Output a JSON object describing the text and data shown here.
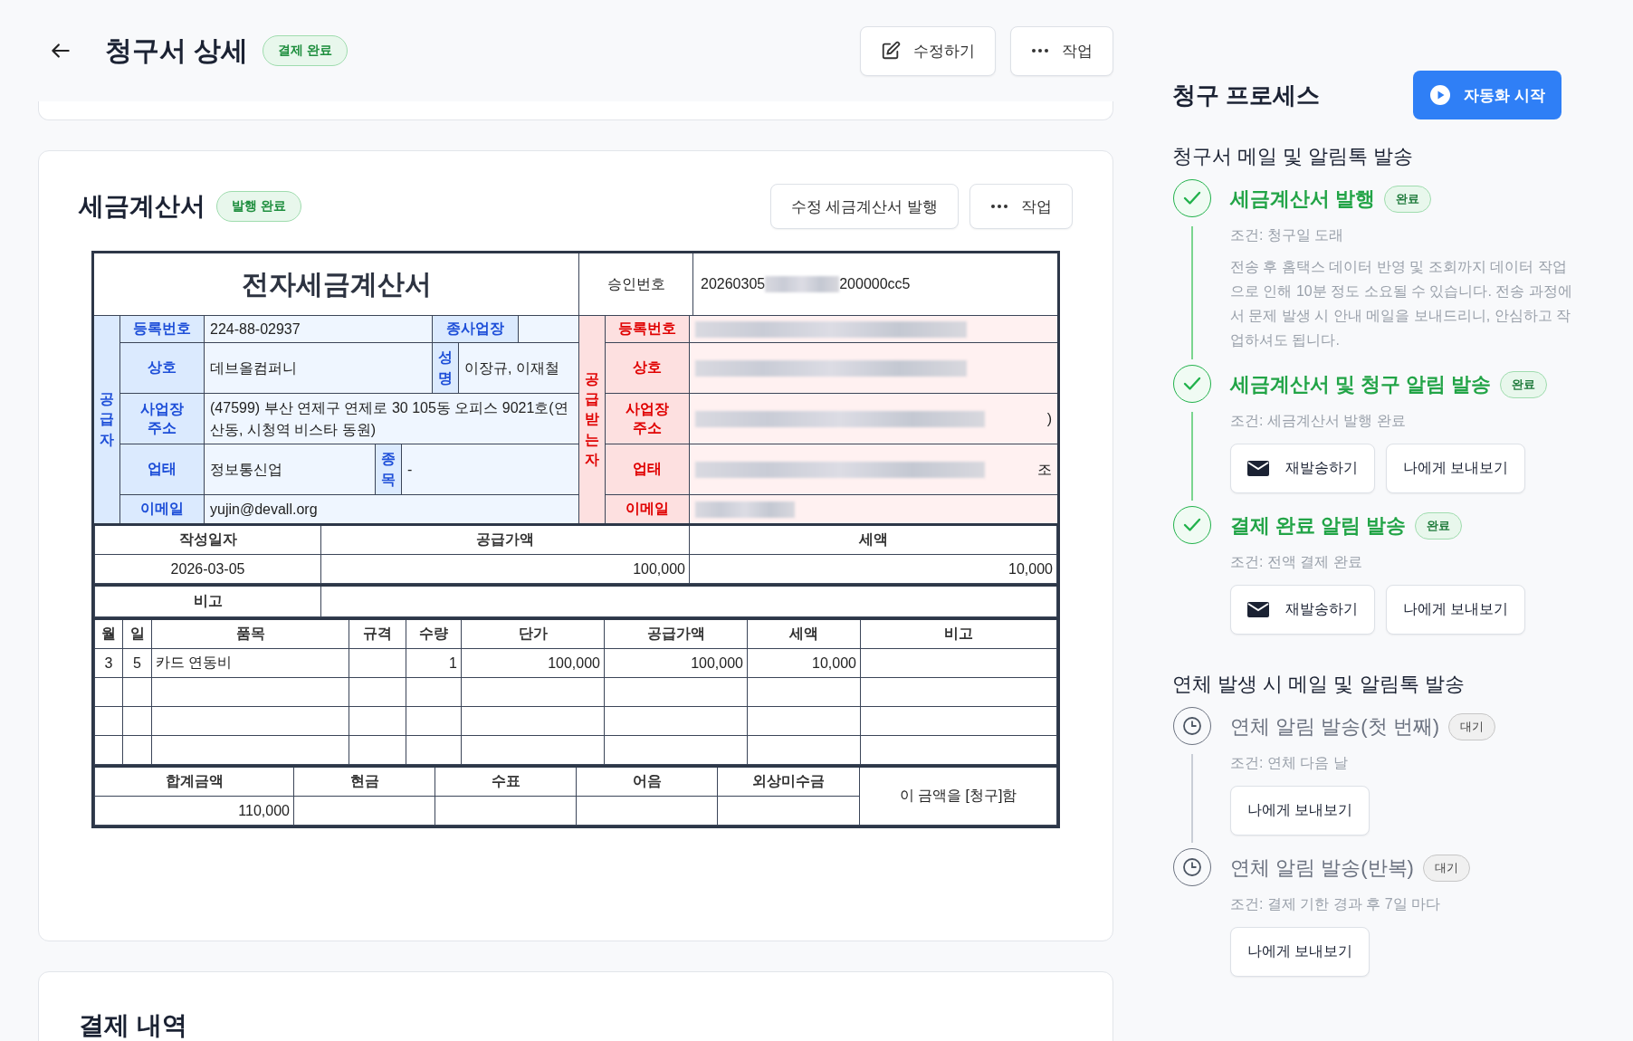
{
  "header": {
    "title": "청구서 상세",
    "status": "결제 완료",
    "buttons": [
      {
        "kind": "edit",
        "label": "수정하기"
      },
      {
        "kind": "more",
        "label": "작업"
      }
    ]
  },
  "tax_invoice": {
    "title": "세금계산서",
    "status": "발행 완료",
    "buttons": [
      {
        "kind": "plain",
        "label": "수정 세금계산서 발행"
      },
      {
        "kind": "more",
        "label": "작업"
      }
    ],
    "document": {
      "title": "전자세금계산서",
      "approval_label": "승인번호",
      "approval_number_start": "20260305",
      "approval_number_end": "200000cc5",
      "supplier": {
        "side_label": "공급자",
        "reg_label": "등록번호",
        "reg": "224-88-02937",
        "branch_label": "종사업장",
        "name_label": "상호",
        "name": "데브올컴퍼니",
        "rep_label": "성명",
        "rep": "이장규, 이재철",
        "addr_label": "사업장 주소",
        "addr": "(47599) 부산 연제구 연제로 30 105동 오피스 9021호(연산동, 시청역 비스타 동원)",
        "biz_label": "업태",
        "biz": "정보통신업",
        "item_label": "종목",
        "item": "-",
        "email_label": "이메일",
        "email": "yujin@devall.org"
      },
      "recipient": {
        "side_label": "공급받는자",
        "reg_label": "등록번호",
        "name_label": "상호",
        "addr_label": "사업장 주소",
        "addr_tail": ")",
        "biz_label": "업태",
        "item_tail": "조",
        "email_label": "이메일"
      },
      "summary": {
        "headers": [
          "작성일자",
          "공급가액",
          "세액"
        ],
        "values": [
          "2026-03-05",
          "100,000",
          "10,000"
        ]
      },
      "remarks_label": "비고",
      "items": {
        "columns": [
          "월",
          "일",
          "품목",
          "규격",
          "수량",
          "단가",
          "공급가액",
          "세액",
          "비고"
        ],
        "rows": [
          {
            "month": "3",
            "day": "5",
            "name": "카드 연동비",
            "qty": "1",
            "unit_price": "100,000",
            "supply": "100,000",
            "tax": "10,000"
          }
        ]
      },
      "totals": {
        "headers": [
          "합계금액",
          "현금",
          "수표",
          "어음",
          "외상미수금"
        ],
        "total": "110,000",
        "claim_note": "이 금액을 [청구]함"
      }
    }
  },
  "payment_section": {
    "title": "결제 내역"
  },
  "process": {
    "title": "청구 프로세스",
    "start_button": "자동화 시작",
    "groups": [
      {
        "title": "청구서 메일 및 알림톡 발송",
        "steps": [
          {
            "completed": true,
            "title": "세금계산서 발행",
            "badge": "완료",
            "condition": "조건: 청구일 도래",
            "note": "전송 후 홈택스 데이터 반영 및 조회까지 데이터 작업으로 인해 10분 정도 소요될 수 있습니다. 전송 과정에서 문제 발생 시 안내 메일을 보내드리니, 안심하고 작업하셔도 됩니다."
          },
          {
            "completed": true,
            "title": "세금계산서 및 청구 알림 발송",
            "badge": "완료",
            "condition": "조건: 세금계산서 발행 완료",
            "actions": [
              {
                "kind": "resend",
                "label": "재발송하기"
              },
              {
                "kind": "preview",
                "label": "나에게 보내보기"
              }
            ]
          },
          {
            "completed": true,
            "title": "결제 완료 알림 발송",
            "badge": "완료",
            "condition": "조건: 전액 결제 완료",
            "actions": [
              {
                "kind": "resend",
                "label": "재발송하기"
              },
              {
                "kind": "preview",
                "label": "나에게 보내보기"
              }
            ]
          }
        ]
      },
      {
        "title": "연체 발생 시 메일 및 알림톡 발송",
        "steps": [
          {
            "completed": false,
            "title": "연체 알림 발송(첫 번째)",
            "badge": "대기",
            "condition": "조건: 연체 다음 날",
            "actions": [
              {
                "kind": "preview",
                "label": "나에게 보내보기"
              }
            ]
          },
          {
            "completed": false,
            "title": "연체 알림 발송(반복)",
            "badge": "대기",
            "condition": "조건: 결제 기한 경과 후 7일 마다",
            "actions": [
              {
                "kind": "preview",
                "label": "나에게 보내보기"
              }
            ]
          }
        ]
      }
    ]
  }
}
